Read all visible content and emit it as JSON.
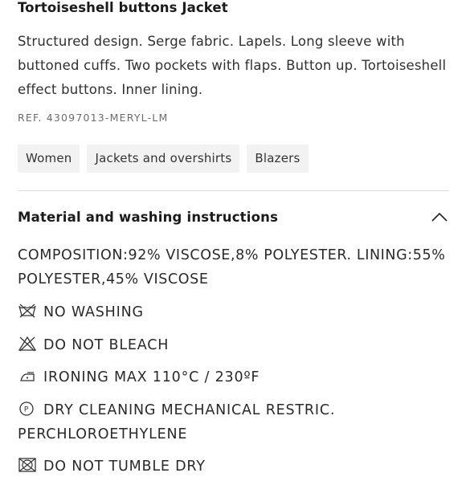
{
  "product": {
    "title": "Tortoiseshell buttons Jacket",
    "description": "Structured design. Serge fabric. Lapels. Long sleeve with buttoned cuffs. Two pockets with flaps. Button up. Tortoiseshell effect buttons. Inner lining.",
    "ref": "REF. 43097013-MERYL-LM"
  },
  "tags": [
    "Women",
    "Jackets and overshirts",
    "Blazers"
  ],
  "material_section": {
    "title": "Material and washing instructions",
    "expanded": true,
    "toggle_icon": "chevron-up-icon",
    "composition": "COMPOSITION:92% VISCOSE,8% POLYESTER. LINING:55% POLYESTER,45% VISCOSE",
    "care": [
      {
        "icon": "no-washing-icon",
        "text": "NO WASHING"
      },
      {
        "icon": "do-not-bleach-icon",
        "text": "DO NOT BLEACH"
      },
      {
        "icon": "ironing-icon",
        "text": "IRONING MAX 110°C / 230ºF"
      },
      {
        "icon": "dry-cleaning-icon",
        "text": "DRY CLEANING MECHANICAL RESTRIC. PERCHLOROETHYLENE"
      },
      {
        "icon": "do-not-tumble-dry-icon",
        "text": "DO NOT TUMBLE DRY"
      }
    ]
  }
}
